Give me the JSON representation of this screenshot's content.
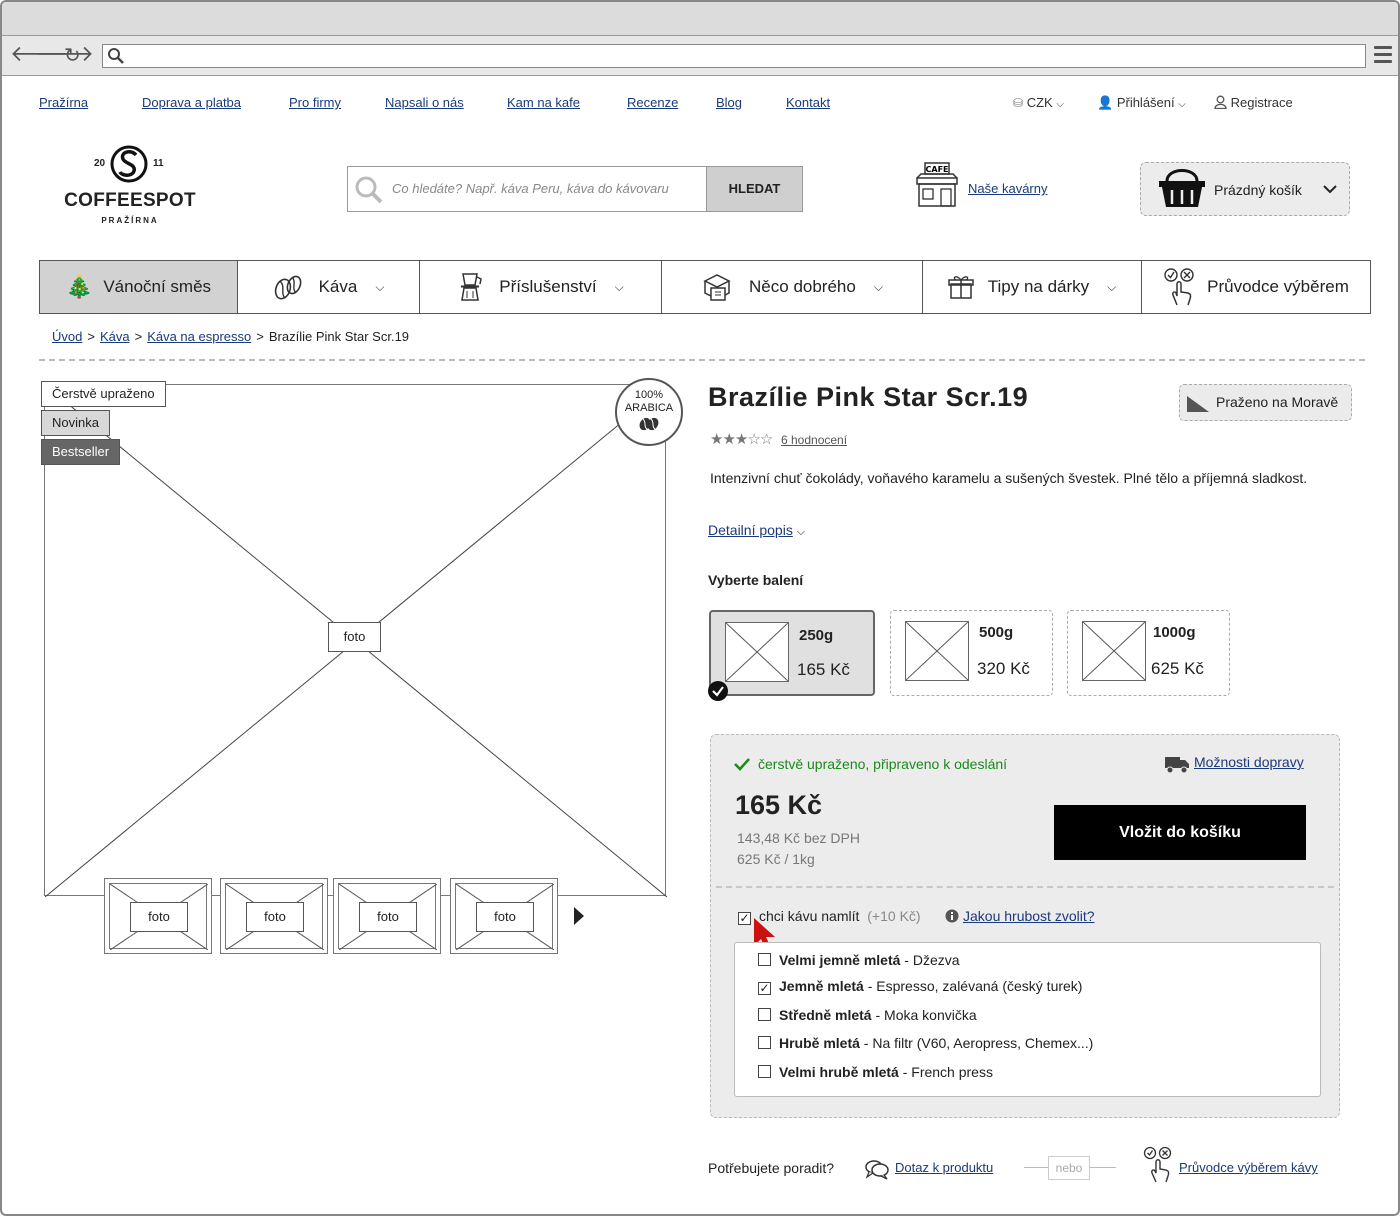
{
  "top_links": [
    "Pražírna",
    "Doprava a platba",
    "Pro firmy",
    "Napsali o nás",
    "Kam na kafe",
    "Recenze",
    "Blog",
    "Kontakt"
  ],
  "utility": {
    "currency": "CZK",
    "login": "Přihlášení",
    "register": "Registrace"
  },
  "logo": {
    "year_left": "20",
    "year_right": "11",
    "name": "COFFEESPOT",
    "sub": "PRAŽÍRNA"
  },
  "search": {
    "placeholder": "Co hledáte? Např. káva Peru, káva do kávovaru",
    "button": "HLEDAT"
  },
  "cafes": {
    "label": "Naše kavárny",
    "sign": "CAFE"
  },
  "cart": {
    "label": "Prázdný košík"
  },
  "main_nav": [
    "Vánoční směs",
    "Káva",
    "Příslušenství",
    "Něco dobrého",
    "Tipy na dárky",
    "Průvodce výběrem"
  ],
  "breadcrumb": [
    "Úvod",
    "Káva",
    "Káva na espresso",
    "Brazílie Pink Star Scr.19"
  ],
  "badges": [
    "Čerstvě upraženo",
    "Novinka",
    "Bestseller"
  ],
  "arabica": {
    "line1": "100%",
    "line2": "ARABICA"
  },
  "image": {
    "main_label": "foto",
    "thumbs": [
      "foto",
      "foto",
      "foto",
      "foto"
    ]
  },
  "product": {
    "title": "Brazílie Pink Star Scr.19",
    "roasted": "Praženo na Moravě",
    "rating_count": "6 hodnocení",
    "rating": 3,
    "rating_max": 5,
    "description": "Intenzivní chuť čokolády, voňavého karamelu a sušených švestek. Plné tělo a příjemná sladkost.",
    "detail_link": "Detailní popis"
  },
  "packaging": {
    "heading": "Vyberte balení",
    "options": [
      {
        "weight": "250g",
        "price": "165 Kč",
        "selected": true
      },
      {
        "weight": "500g",
        "price": "320 Kč",
        "selected": false
      },
      {
        "weight": "1000g",
        "price": "625 Kč",
        "selected": false
      }
    ]
  },
  "buy": {
    "stock": "čerstvě upraženo, připraveno k odeslání",
    "shipping_link": "Možnosti dopravy",
    "price": "165 Kč",
    "price_no_vat": "143,48 Kč bez DPH",
    "unit_price": "625 Kč / 1kg",
    "button": "Vložit do košíku",
    "grind_label": "chci kávu namlít",
    "grind_extra": "(+10 Kč)",
    "grind_help": "Jakou hrubost zvolit?",
    "grind_checked": true,
    "grind_options": [
      {
        "name": "Velmi jemně mletá",
        "desc": " - Džezva",
        "checked": false
      },
      {
        "name": "Jemně mletá",
        "desc": " - Espresso, zalévaná (český turek)",
        "checked": true
      },
      {
        "name": "Středně mletá",
        "desc": " - Moka konvička",
        "checked": false
      },
      {
        "name": "Hrubě mletá",
        "desc": " - Na filtr (V60, Aeropress, Chemex...)",
        "checked": false
      },
      {
        "name": "Velmi hrubě mletá",
        "desc": " - French press",
        "checked": false
      }
    ]
  },
  "help": {
    "question": "Potřebujete poradit?",
    "ask_link": "Dotaz k produktu",
    "or": "nebo",
    "guide_link": "Průvodce výběrem kávy"
  },
  "colors": {
    "accent": "#1a3a7a",
    "ok": "#1a8a1a",
    "cursor": "#cc1111"
  }
}
